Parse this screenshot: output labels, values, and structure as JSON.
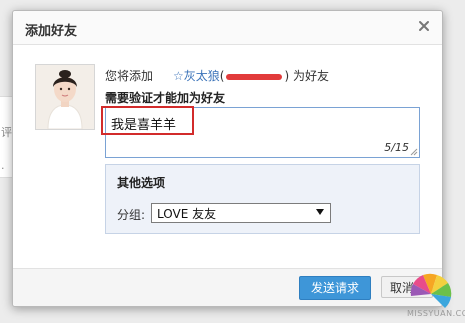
{
  "background": {
    "fragments": [
      "评",
      "·"
    ]
  },
  "dialog": {
    "title": "添加好友",
    "add_prefix": "您将添加",
    "nickname": "　☆灰太狼",
    "account_open": "(",
    "account_close": ")",
    "add_suffix": "为好友",
    "verify_label": "需要验证才能加为好友",
    "message_value": "我是喜羊羊",
    "char_count": "5/15",
    "options": {
      "title": "其他选项",
      "group_label": "分组:",
      "group_selected": "LOVE 友友"
    },
    "buttons": {
      "send": "发送请求",
      "cancel": "取消"
    }
  },
  "watermark": "MISSYUAN.COM",
  "colors": {
    "accent": "#3e96d8",
    "highlight": "#d22b2b",
    "link": "#3b73b9",
    "option_bg": "#eef2f9"
  },
  "icons": [
    "close-icon",
    "dropdown-arrow-icon",
    "resize-grip-icon",
    "avatar"
  ]
}
